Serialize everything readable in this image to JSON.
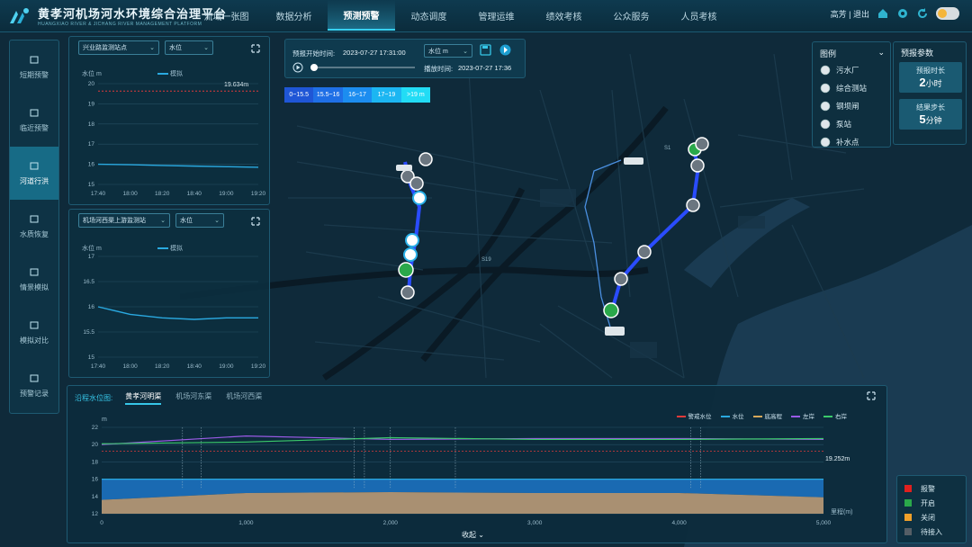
{
  "app": {
    "title": "黄孝河机场河水环境综合治理平台",
    "subtitle": "HUANGXIAO RIVER & JICHANG RIVER MANAGEMENT PLATFORM"
  },
  "nav": [
    {
      "label": "流域一张图"
    },
    {
      "label": "数据分析"
    },
    {
      "label": "预测预警"
    },
    {
      "label": "动态调度"
    },
    {
      "label": "管理运维"
    },
    {
      "label": "绩效考核"
    },
    {
      "label": "公众服务"
    },
    {
      "label": "人员考核"
    }
  ],
  "nav_active": 2,
  "user": {
    "name": "高芳",
    "logout": "退出"
  },
  "sidebar": [
    {
      "label": "短期预警"
    },
    {
      "label": "临近预警"
    },
    {
      "label": "河道行洪"
    },
    {
      "label": "水质恢复"
    },
    {
      "label": "情景模拟"
    },
    {
      "label": "模拟对比"
    },
    {
      "label": "预警记录"
    }
  ],
  "sidebar_active": 2,
  "chart1": {
    "station": "兴业路监测站点",
    "metric": "水位",
    "ylabel": "水位 m",
    "series": "模拟",
    "annotation": "19.634m"
  },
  "chart2": {
    "station": "机场河西渠上游监测站",
    "metric": "水位",
    "ylabel": "水位 m",
    "series": "模拟"
  },
  "control": {
    "start_label": "预报开始时间:",
    "start_time": "2023-07-27 17:31:00",
    "param": "水位 m",
    "play_label": "播放时间:",
    "play_time": "2023-07-27 17:36"
  },
  "range_legend": [
    {
      "label": "0~15.5",
      "color": "#1f56d6"
    },
    {
      "label": "15.5~16",
      "color": "#1f6fe6"
    },
    {
      "label": "16~17",
      "color": "#1c8df0"
    },
    {
      "label": "17~19",
      "color": "#1cb6f2"
    },
    {
      "label": ">19 m",
      "color": "#22dcf5"
    }
  ],
  "legend": {
    "title": "图例",
    "items": [
      {
        "label": "污水厂"
      },
      {
        "label": "综合测站"
      },
      {
        "label": "钢坝闸"
      },
      {
        "label": "泵站"
      },
      {
        "label": "补水点"
      }
    ]
  },
  "forecast": {
    "title": "预报参数",
    "duration_label": "预报时长",
    "duration_value": "2",
    "duration_unit": "小时",
    "step_label": "结果步长",
    "step_value": "5",
    "step_unit": "分钟"
  },
  "profile": {
    "header": "沿程水位图:",
    "tabs": [
      {
        "label": "黄孝河明渠"
      },
      {
        "label": "机场河东渠"
      },
      {
        "label": "机场河西渠"
      }
    ],
    "active_tab": 0,
    "annotation": "19.252m",
    "xunit": "里程(m)",
    "collapse": "收起",
    "legend": [
      {
        "label": "警戒水位",
        "color": "#e03a3a"
      },
      {
        "label": "水位",
        "color": "#2aa9e0"
      },
      {
        "label": "底高程",
        "color": "#d6a85a"
      },
      {
        "label": "左岸",
        "color": "#9a5ae6"
      },
      {
        "label": "右岸",
        "color": "#3ac96a"
      }
    ],
    "ylabel": "m"
  },
  "status": [
    {
      "label": "报警",
      "color": "#e0201e"
    },
    {
      "label": "开启",
      "color": "#2aa84a"
    },
    {
      "label": "关闭",
      "color": "#f0a02a"
    },
    {
      "label": "待接入",
      "color": "#555e66"
    }
  ],
  "map_labels": [
    "S1",
    "S19"
  ],
  "chart_data": [
    {
      "type": "line",
      "x": [
        "17:40",
        "18:00",
        "18:20",
        "18:40",
        "19:00",
        "19:20"
      ],
      "series": [
        {
          "name": "模拟",
          "values": [
            16.0,
            15.98,
            15.94,
            15.91,
            15.88,
            15.85
          ]
        }
      ],
      "ylim": [
        15,
        20
      ],
      "yticks": [
        15,
        16,
        17,
        18,
        19,
        20
      ],
      "ylabel": "水位 m",
      "warning": 19.634
    },
    {
      "type": "line",
      "x": [
        "17:40",
        "18:00",
        "18:20",
        "18:40",
        "19:00",
        "19:20"
      ],
      "series": [
        {
          "name": "模拟",
          "values": [
            16.0,
            15.85,
            15.78,
            15.75,
            15.78,
            15.78
          ]
        }
      ],
      "ylim": [
        15,
        17
      ],
      "yticks": [
        15,
        15.5,
        16,
        16.5,
        17
      ],
      "ylabel": "水位 m"
    },
    {
      "type": "line",
      "x": [
        0,
        1000,
        2000,
        3000,
        4000,
        5000
      ],
      "ylim": [
        12,
        22
      ],
      "yticks": [
        12,
        14,
        16,
        18,
        20,
        22
      ],
      "xunit": "里程(m)",
      "warning": 19.252,
      "series": [
        {
          "name": "水位",
          "values": [
            16,
            16,
            16,
            16,
            16,
            16
          ]
        },
        {
          "name": "底高程",
          "values": [
            13.6,
            14.4,
            14.5,
            14.4,
            14.4,
            13.9
          ]
        },
        {
          "name": "左岸",
          "values": [
            20,
            21,
            20.6,
            20.7,
            20.7,
            20.6
          ]
        },
        {
          "name": "右岸",
          "values": [
            20.1,
            20.3,
            20.8,
            20.6,
            20.6,
            20.7
          ]
        }
      ]
    }
  ]
}
